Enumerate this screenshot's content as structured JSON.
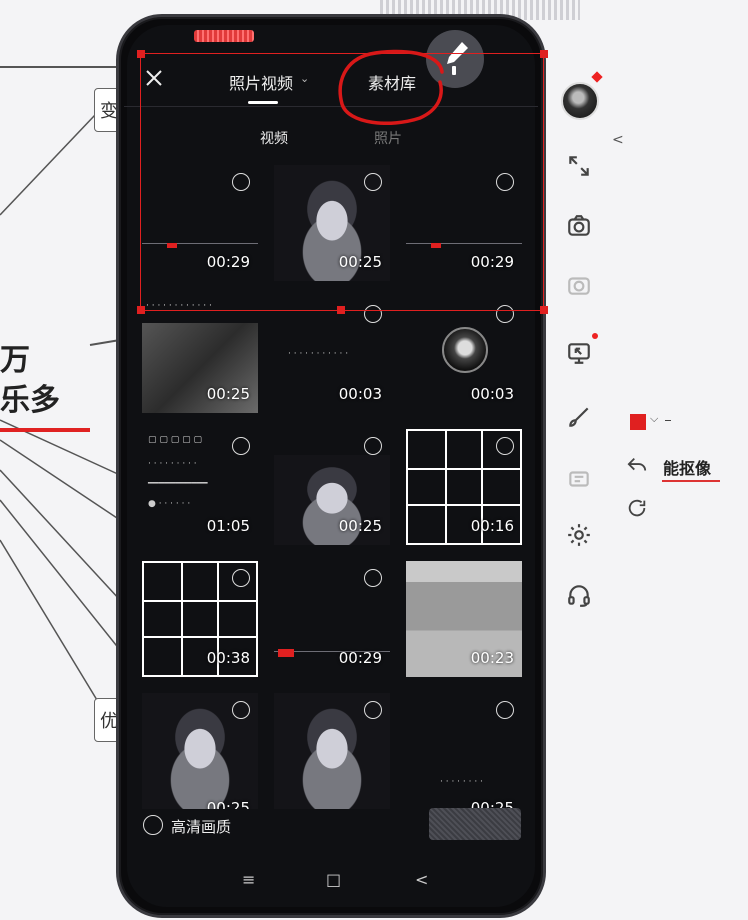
{
  "background": {
    "node_top_char": "变",
    "node_bottom_char": "优",
    "big_text_line1": "万",
    "big_text_line2": "乐多",
    "accent_color": "#e02222"
  },
  "toolbar": {
    "icons": [
      "avatar",
      "fullscreen-icon",
      "camera-icon",
      "camera-off-icon",
      "screen-share-icon",
      "brush-icon",
      "whiteboard-icon",
      "settings-icon",
      "headset-icon"
    ],
    "collapse_arrow": "<",
    "color_swatch": "#e02020",
    "matting_label": "能抠像"
  },
  "picker": {
    "tabs": [
      {
        "label": "照片视频",
        "active": true
      },
      {
        "label": "素材库",
        "active": false
      }
    ],
    "subtabs": [
      {
        "label": "视频",
        "active": true
      },
      {
        "label": "照片",
        "active": false
      }
    ],
    "grid": [
      {
        "duration": "00:29",
        "kind": "dark-wave"
      },
      {
        "duration": "00:25",
        "kind": "girl"
      },
      {
        "duration": "00:29",
        "kind": "dark-wave"
      },
      {
        "duration": "00:25",
        "kind": "dark-photo"
      },
      {
        "duration": "00:03",
        "kind": "text-line"
      },
      {
        "duration": "00:03",
        "kind": "avatar"
      },
      {
        "duration": "01:05",
        "kind": "ui"
      },
      {
        "duration": "00:25",
        "kind": "girl"
      },
      {
        "duration": "00:16",
        "kind": "grid"
      },
      {
        "duration": "00:38",
        "kind": "grid"
      },
      {
        "duration": "00:29",
        "kind": "dark-wave"
      },
      {
        "duration": "00:23",
        "kind": "room"
      },
      {
        "duration": "00:25",
        "kind": "girl"
      },
      {
        "duration": "",
        "kind": "girl"
      },
      {
        "duration": "00:25",
        "kind": "dark"
      }
    ],
    "hd_quality_label": "高清画质",
    "confirm_button": ""
  },
  "system_nav": {
    "menu": "≡",
    "home": "□",
    "back": "<"
  }
}
